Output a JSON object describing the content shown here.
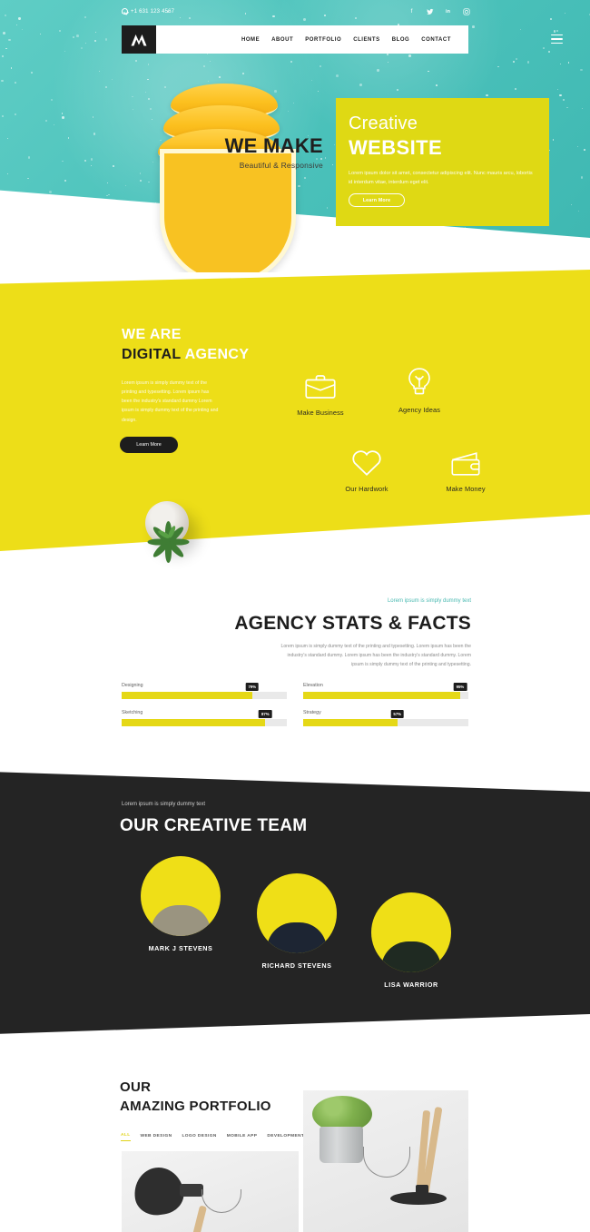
{
  "topbar": {
    "phone": "+1 631 123 4567",
    "phone_icon": "phone-circle-icon",
    "socials": [
      {
        "name": "facebook-icon",
        "glyph": "f"
      },
      {
        "name": "twitter-icon",
        "glyph": "✉"
      },
      {
        "name": "linkedin-icon",
        "glyph": "in"
      },
      {
        "name": "instagram-icon",
        "glyph": "▣"
      }
    ]
  },
  "nav": {
    "logo_alt": "M logo",
    "links": [
      "HOME",
      "ABOUT",
      "PORTFOLIO",
      "CLIENTS",
      "BLOG",
      "CONTACT"
    ],
    "menu_toggle": "hamburger-menu-icon"
  },
  "hero": {
    "overline": "WE MAKE",
    "subline": "Beautiful & Responsive",
    "card": {
      "title_light": "Creative",
      "title_bold": "WEBSITE",
      "paragraph": "Lorem ipsum dolor sit amet, consectetur adipiscing elit. Nunc mauris arcu, lobortis id interdum vitae, interdum eget elit.",
      "button": "Learn More",
      "bg_color": "#dfd914"
    }
  },
  "agency": {
    "title_line1": "WE ARE",
    "title_line2_dark": "DIGITAL",
    "title_line2_light": "AGENCY",
    "paragraph": "Lorem ipsum is simply dummy text of the printing and typesetting. Lorem ipsum has been the industry's standard dummy Lorem ipsum is simply dummy text of the printing and design.",
    "button": "Learn More",
    "bg_color": "#edde18",
    "features": [
      {
        "icon": "briefcase-icon",
        "label": "Make Business"
      },
      {
        "icon": "lightbulb-idea-icon",
        "label": "Agency Ideas"
      },
      {
        "icon": "heart-icon",
        "label": "Our Hardwork"
      },
      {
        "icon": "wallet-icon",
        "label": "Make Money"
      }
    ]
  },
  "stats": {
    "eyebrow": "Lorem ipsum is simply dummy text",
    "title": "AGENCY STATS & FACTS",
    "paragraph": "Lorem ipsum is simply dummy text of the printing and typesetting. Lorem ipsum has been the industry's standard dummy. Lorem ipsum has been the industry's standard dummy. Lorem ipsum is simply dummy text of the printing and typesetting.",
    "accent_color": "#49b9b1",
    "bar_color": "#e5d816",
    "bars": [
      {
        "label": "Designing",
        "value": 79,
        "display": "79%"
      },
      {
        "label": "Elevation",
        "value": 95,
        "display": "95%"
      },
      {
        "label": "Sketching",
        "value": 87,
        "display": "87%"
      },
      {
        "label": "Strategy",
        "value": 57,
        "display": "57%"
      }
    ]
  },
  "team": {
    "eyebrow": "Lorem ipsum is simply dummy text",
    "title": "OUR CREATIVE TEAM",
    "bg_color": "#242424",
    "circle_color": "#efdf17",
    "members": [
      {
        "name": "MARK J STEVENS"
      },
      {
        "name": "RICHARD STEVENS"
      },
      {
        "name": "LISA WARRIOR"
      }
    ]
  },
  "portfolio": {
    "title_line1": "OUR",
    "title_line2": "AMAZING PORTFOLIO",
    "filters": [
      {
        "label": "ALL",
        "active": true
      },
      {
        "label": "WEB DESIGN",
        "active": false
      },
      {
        "label": "LOGO DESIGN",
        "active": false
      },
      {
        "label": "MOBILE APP",
        "active": false
      },
      {
        "label": "DEVELOPMENT",
        "active": false
      }
    ],
    "items": [
      {
        "alt": "black desk lamp photo"
      },
      {
        "alt": "plant and wooden lamp photo"
      }
    ]
  }
}
